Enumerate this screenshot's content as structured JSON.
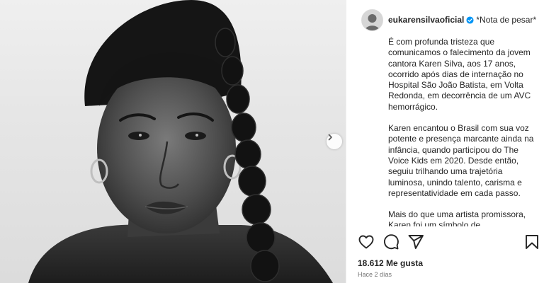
{
  "post": {
    "username": "eukarensilvaoficial",
    "caption_title": "*Nota de pesar*",
    "paragraphs": [
      "É com profunda tristeza que comunicamos o falecimento da jovem cantora Karen Silva, aos 17 anos, ocorrido após dias de internação no Hospital São João Batista, em Volta Redonda, em decorrência de um AVC hemorrágico.",
      "Karen encantou o Brasil com sua voz potente e presença marcante ainda na infância, quando participou do The Voice Kids em 2020. Desde então, seguiu trilhando uma trajetória luminosa, unindo talento, carisma e representatividade em cada passo.",
      "Mais do que uma artista promissora, Karen foi um símbolo de"
    ],
    "likes": "18.612",
    "likes_label": "Me gusta",
    "timestamp": "Hace 2 días"
  },
  "icons": {
    "verified": "verified-badge-icon",
    "next": "chevron-right-icon",
    "like": "heart-icon",
    "comment": "comment-icon",
    "share": "send-icon",
    "save": "bookmark-icon"
  },
  "colors": {
    "verified_blue": "#0095f6",
    "text": "#262626",
    "muted": "#737373"
  }
}
